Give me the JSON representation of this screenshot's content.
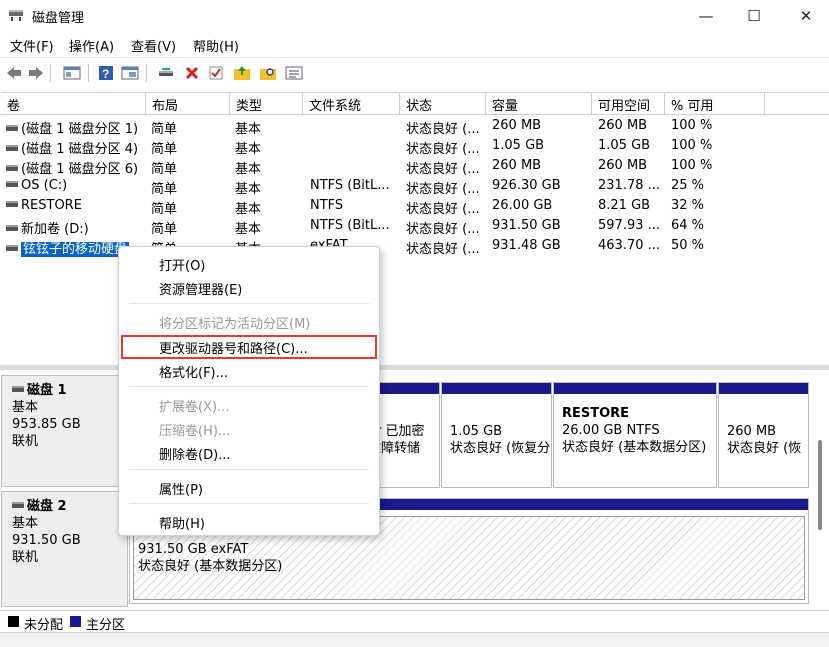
{
  "window": {
    "title": "磁盘管理",
    "minimize": "—",
    "maximize": "☐",
    "close": "✕"
  },
  "menu": [
    "文件(F)",
    "操作(A)",
    "查看(V)",
    "帮助(H)"
  ],
  "columns": [
    "卷",
    "布局",
    "类型",
    "文件系统",
    "状态",
    "容量",
    "可用空间",
    "% 可用"
  ],
  "volumes": [
    {
      "name": "(磁盘 1 磁盘分区 1)",
      "layout": "简单",
      "type": "基本",
      "fs": "",
      "status": "状态良好 (...",
      "capacity": "260 MB",
      "free": "260 MB",
      "pct": "100 %"
    },
    {
      "name": "(磁盘 1 磁盘分区 4)",
      "layout": "简单",
      "type": "基本",
      "fs": "",
      "status": "状态良好 (...",
      "capacity": "1.05 GB",
      "free": "1.05 GB",
      "pct": "100 %"
    },
    {
      "name": "(磁盘 1 磁盘分区 6)",
      "layout": "简单",
      "type": "基本",
      "fs": "",
      "status": "状态良好 (...",
      "capacity": "260 MB",
      "free": "260 MB",
      "pct": "100 %"
    },
    {
      "name": "OS (C:)",
      "layout": "简单",
      "type": "基本",
      "fs": "NTFS (BitL...",
      "status": "状态良好 (...",
      "capacity": "926.30 GB",
      "free": "231.78 ...",
      "pct": "25 %"
    },
    {
      "name": "RESTORE",
      "layout": "简单",
      "type": "基本",
      "fs": "NTFS",
      "status": "状态良好 (...",
      "capacity": "26.00 GB",
      "free": "8.21 GB",
      "pct": "32 %"
    },
    {
      "name": "新加卷 (D:)",
      "layout": "简单",
      "type": "基本",
      "fs": "NTFS (BitL...",
      "status": "状态良好 (...",
      "capacity": "931.50 GB",
      "free": "597.93 ...",
      "pct": "64 %"
    },
    {
      "name": "铉铉子的移动硬盘",
      "layout": "简单",
      "type": "基本",
      "fs": "exFAT",
      "status": "状态良好 (...",
      "capacity": "931.48 GB",
      "free": "463.70 ...",
      "pct": "50 %"
    }
  ],
  "disks": [
    {
      "name": "磁盘 1",
      "kind": "基本",
      "size": "953.85 GB",
      "state": "联机",
      "partitions": [
        {
          "title": "",
          "line1": "er 已加密",
          "line2": "故障转储"
        },
        {
          "title": "",
          "line1": "1.05 GB",
          "line2": "状态良好 (恢复分"
        },
        {
          "title": "RESTORE",
          "line1": "26.00 GB NTFS",
          "line2": "状态良好 (基本数据分区)"
        },
        {
          "title": "",
          "line1": "260 MB",
          "line2": "状态良好 (恢"
        }
      ]
    },
    {
      "name": "磁盘 2",
      "kind": "基本",
      "size": "931.50 GB",
      "state": "联机",
      "partitions": [
        {
          "title": "",
          "line1": "931.50 GB exFAT",
          "line2": "状态良好 (基本数据分区)"
        }
      ]
    }
  ],
  "context_menu": [
    {
      "label": "打开(O)",
      "enabled": true
    },
    {
      "label": "资源管理器(E)",
      "enabled": true
    },
    {
      "label": "将分区标记为活动分区(M)",
      "enabled": false
    },
    {
      "label": "更改驱动器号和路径(C)...",
      "enabled": true
    },
    {
      "label": "格式化(F)...",
      "enabled": true
    },
    {
      "label": "扩展卷(X)...",
      "enabled": false
    },
    {
      "label": "压缩卷(H)...",
      "enabled": false
    },
    {
      "label": "删除卷(D)...",
      "enabled": true
    },
    {
      "label": "属性(P)",
      "enabled": true
    },
    {
      "label": "帮助(H)",
      "enabled": true
    }
  ],
  "legend": {
    "unallocated": "未分配",
    "primary": "主分区"
  },
  "colors": {
    "primary": "#1a1a8c",
    "highlight": "#e53b2a",
    "selection": "#0a64c8"
  }
}
